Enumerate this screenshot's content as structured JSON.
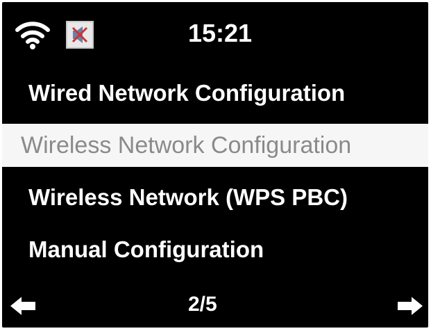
{
  "status": {
    "time": "15:21",
    "icons": [
      "wifi-icon",
      "mute-icon"
    ]
  },
  "menu": {
    "items": [
      {
        "label": "Wired Network Configuration",
        "selected": false
      },
      {
        "label": "Wireless Network Configuration",
        "selected": true
      },
      {
        "label": "Wireless Network (WPS PBC)",
        "selected": false
      },
      {
        "label": "Manual Configuration",
        "selected": false
      }
    ]
  },
  "footer": {
    "page": "2/5",
    "icons": [
      "arrow-left-icon",
      "arrow-right-icon"
    ]
  },
  "colors": {
    "screen_bg": "#000000",
    "text": "#ffffff",
    "selected_bg": "#f6f6f6",
    "selected_text": "#8a8a8a",
    "mute_x": "#cc3333"
  }
}
